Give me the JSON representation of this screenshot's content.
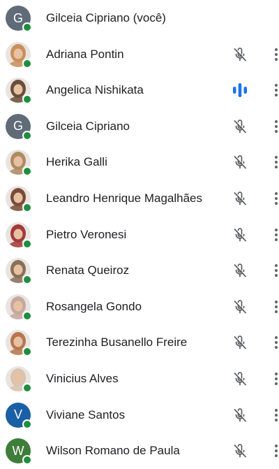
{
  "colors": {
    "online_status": "#1e8e3e",
    "muted_icon": "#5f6368",
    "speaking_accent": "#1a73e8",
    "text": "#202124"
  },
  "participants": [
    {
      "name": "Gilceia Cipriano (você)",
      "avatar_type": "initial",
      "initial": "G",
      "avatar_color": "#5f6b77",
      "mic": "none"
    },
    {
      "name": "Adriana Pontin",
      "avatar_type": "photo",
      "avatar_color": "#c98f5b",
      "mic": "muted"
    },
    {
      "name": "Angelica Nishikata",
      "avatar_type": "photo",
      "avatar_color": "#6b4e3a",
      "mic": "speaking"
    },
    {
      "name": "Gilceia Cipriano",
      "avatar_type": "initial",
      "initial": "G",
      "avatar_color": "#5f6b77",
      "mic": "muted"
    },
    {
      "name": "Herika Galli",
      "avatar_type": "photo",
      "avatar_color": "#b08a62",
      "mic": "muted"
    },
    {
      "name": "Leandro Henrique Magalhães",
      "avatar_type": "photo",
      "avatar_color": "#7a4b38",
      "mic": "muted"
    },
    {
      "name": "Pietro Veronesi",
      "avatar_type": "photo",
      "avatar_color": "#a23a3a",
      "mic": "muted"
    },
    {
      "name": "Renata Queiroz",
      "avatar_type": "photo",
      "avatar_color": "#8a6f58",
      "mic": "muted"
    },
    {
      "name": "Rosangela Gondo",
      "avatar_type": "photo",
      "avatar_color": "#c7a7a0",
      "mic": "muted"
    },
    {
      "name": "Terezinha Busanello Freire",
      "avatar_type": "photo",
      "avatar_color": "#b7764e",
      "mic": "muted"
    },
    {
      "name": "Vinicius Alves",
      "avatar_type": "photo",
      "avatar_color": "#d8c4b0",
      "mic": "muted"
    },
    {
      "name": "Viviane Santos",
      "avatar_type": "initial",
      "initial": "V",
      "avatar_color": "#1a5fa6",
      "mic": "muted"
    },
    {
      "name": "Wilson Romano de Paula",
      "avatar_type": "initial",
      "initial": "W",
      "avatar_color": "#3f7d3a",
      "mic": "muted"
    }
  ]
}
